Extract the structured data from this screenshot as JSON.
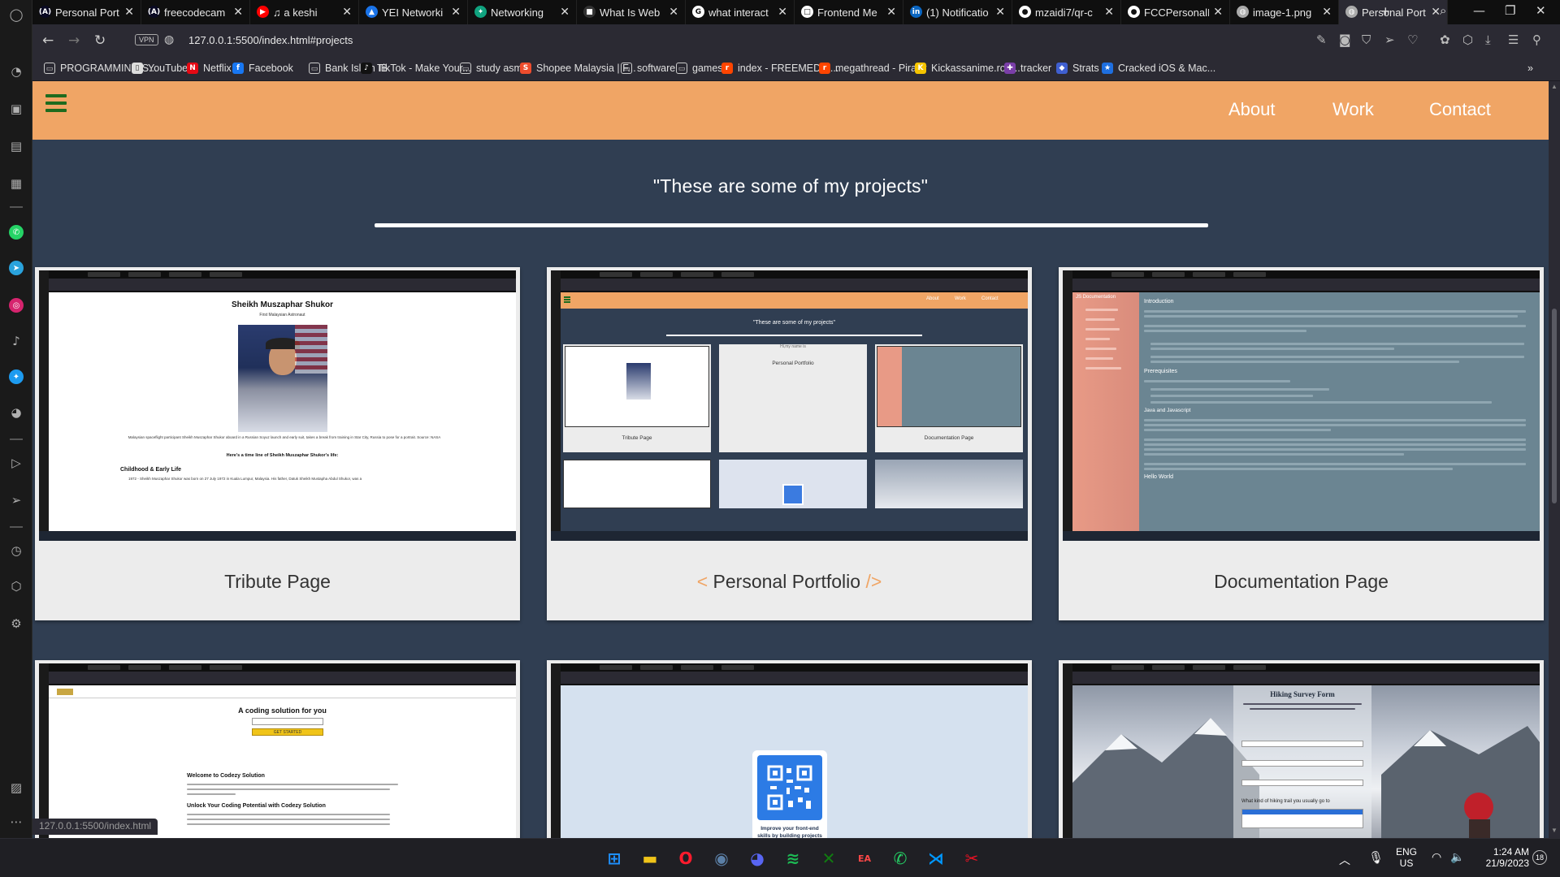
{
  "browser": {
    "tabs": [
      {
        "label": "Personal Port",
        "favicon": "freecodecamp-icon",
        "color": "#0a0a23",
        "glyph": "(A)"
      },
      {
        "label": "freecodecam",
        "favicon": "freecodecamp-icon",
        "color": "#0a0a23",
        "glyph": "(A)"
      },
      {
        "label": "♫ a keshi",
        "favicon": "youtube-icon",
        "color": "#ff0000",
        "glyph": "▶"
      },
      {
        "label": "YEI Networki",
        "favicon": "drive-icon",
        "color": "#1a73e8",
        "glyph": "▲"
      },
      {
        "label": "Networking",
        "favicon": "chatgpt-icon",
        "color": "#10a37f",
        "glyph": "✦"
      },
      {
        "label": "What Is Web",
        "favicon": "site-icon",
        "color": "#333333",
        "glyph": "■"
      },
      {
        "label": "what interact",
        "favicon": "google-icon",
        "color": "#ffffff",
        "glyph": "G"
      },
      {
        "label": "Frontend Me",
        "favicon": "page-icon",
        "color": "#ffffff",
        "glyph": "□"
      },
      {
        "label": "(1) Notificatio",
        "favicon": "linkedin-icon",
        "color": "#0a66c2",
        "glyph": "in"
      },
      {
        "label": "mzaidi7/qr-c",
        "favicon": "github-icon",
        "color": "#ffffff",
        "glyph": "●"
      },
      {
        "label": "FCCPersonalP",
        "favicon": "github-icon",
        "color": "#ffffff",
        "glyph": "●"
      },
      {
        "label": "image-1.png",
        "favicon": "globe-icon",
        "color": "#aaaaaa",
        "glyph": "◍"
      },
      {
        "label": "Personal Port",
        "favicon": "globe-icon",
        "color": "#aaaaaa",
        "glyph": "◍",
        "active": true
      }
    ],
    "url": "127.0.0.1:5500/index.html#projects",
    "vpn_label": "VPN",
    "status_url": "127.0.0.1:5500/index.html",
    "bookmarks": [
      {
        "label": "PROGRAMMING S...",
        "icon": "folder-icon",
        "color": "#2b2a33",
        "glyph": "▭"
      },
      {
        "label": "YouTube",
        "icon": "page-icon",
        "color": "#dddddd",
        "glyph": "▯"
      },
      {
        "label": "Netflix",
        "icon": "netflix-icon",
        "color": "#e50914",
        "glyph": "N"
      },
      {
        "label": "Facebook",
        "icon": "facebook-icon",
        "color": "#1877f2",
        "glyph": "f"
      },
      {
        "label": "Bank Islam IB",
        "icon": "folder-icon",
        "color": "#2b2a33",
        "glyph": "▭"
      },
      {
        "label": "TikTok - Make Your...",
        "icon": "tiktok-icon",
        "color": "#111111",
        "glyph": "♪"
      },
      {
        "label": "study asmr",
        "icon": "folder-icon",
        "color": "#2b2a33",
        "glyph": "▭"
      },
      {
        "label": "Shopee Malaysia | F...",
        "icon": "shopee-icon",
        "color": "#ee4d2d",
        "glyph": "S"
      },
      {
        "label": "software",
        "icon": "folder-icon",
        "color": "#2b2a33",
        "glyph": "▭"
      },
      {
        "label": "games",
        "icon": "folder-icon",
        "color": "#2b2a33",
        "glyph": "▭"
      },
      {
        "label": "index - FREEMEDIA...",
        "icon": "reddit-icon",
        "color": "#ff4500",
        "glyph": "r"
      },
      {
        "label": "megathread - Piracy",
        "icon": "reddit-icon",
        "color": "#ff4500",
        "glyph": "r"
      },
      {
        "label": "Kickassanime.ro -...",
        "icon": "kickass-icon",
        "color": "#f5c400",
        "glyph": "K"
      },
      {
        "label": "tracker",
        "icon": "tracker-icon",
        "color": "#7a3ea8",
        "glyph": "✚"
      },
      {
        "label": "Strats",
        "icon": "strats-icon",
        "color": "#3f5fd0",
        "glyph": "◆"
      },
      {
        "label": "Cracked iOS & Mac...",
        "icon": "cracked-icon",
        "color": "#1e6fe0",
        "glyph": "★"
      }
    ]
  },
  "site": {
    "nav": {
      "about": "About",
      "work": "Work",
      "contact": "Contact"
    },
    "projects_heading": "\"These are some of my projects\"",
    "projects": [
      {
        "title": "Tribute Page"
      },
      {
        "title_prefix": "< ",
        "title": "Personal Portfolio",
        "title_suffix": " />"
      },
      {
        "title": "Documentation Page"
      },
      {
        "title": ""
      },
      {
        "title": ""
      },
      {
        "title": ""
      }
    ],
    "previews": {
      "tribute": {
        "heading": "Sheikh Muszaphar Shukor",
        "sub": "First Malaysian Astronaut",
        "caption": "Malaysian spaceflight participant Sheikh Muszaphar Shukor aboard in a Russian Soyuz launch and early suit, takes a break from training in Star City, Russia to pose for a portrait. Source: NASA",
        "timeline": "Here's a time line of Sheikh Muszaphar Shukor's life:",
        "section": "Childhood & Early Life",
        "bullet": "1972 - Sheikh Muszaphar Shukor was born on 27 July 1972 in Kuala Lumpur, Malaysia. His father, Datuk Sheikh Mustapha Abdul Shukor, was a"
      },
      "portfolio": {
        "heading": "\"These are some of my projects\"",
        "card1": "Tribute Page",
        "card2": "Personal Portfolio",
        "card3": "Documentation Page",
        "links": [
          "About",
          "Work",
          "Contact"
        ],
        "hint": "Hi,my name is"
      },
      "docs": {
        "nav_title": "JS Documentation",
        "h1": "Introduction",
        "h2": "Prerequisites",
        "h3": "Java and Javascript",
        "h4": "Hello World"
      },
      "landing": {
        "heading": "A coding solution for you",
        "cta": "GET STARTED",
        "welcome": "Welcome to Codezy Solution",
        "unlock": "Unlock Your Coding Potential with Codezy Solution"
      },
      "qr": {
        "caption": "Improve your front-end skills by building projects"
      },
      "survey": {
        "heading": "Hiking Survey Form",
        "question": "What kind of hiking trail you usually go to"
      }
    }
  },
  "taskbar": {
    "apps": [
      {
        "name": "start-icon",
        "glyph": "⊞",
        "color": "#1e90ff"
      },
      {
        "name": "file-explorer-icon",
        "glyph": "▬",
        "color": "#f0c419"
      },
      {
        "name": "opera-icon",
        "glyph": "O",
        "color": "#ff1b2d"
      },
      {
        "name": "steam-icon",
        "glyph": "◉",
        "color": "#5b7fa6"
      },
      {
        "name": "discord-icon",
        "glyph": "◕",
        "color": "#5865f2"
      },
      {
        "name": "spotify-icon",
        "glyph": "≋",
        "color": "#1db954"
      },
      {
        "name": "xbox-icon",
        "glyph": "✕",
        "color": "#107c10"
      },
      {
        "name": "ea-icon",
        "glyph": "EA",
        "color": "#ff4747"
      },
      {
        "name": "whatsapp-icon",
        "glyph": "✆",
        "color": "#25d366"
      },
      {
        "name": "vscode-icon",
        "glyph": "⋊",
        "color": "#0098ff"
      },
      {
        "name": "snipping-tool-icon",
        "glyph": "✂",
        "color": "#e81123"
      }
    ],
    "lang": "ENG",
    "region": "US",
    "time": "1:24 AM",
    "date": "21/9/2023",
    "notification_count": "18"
  }
}
